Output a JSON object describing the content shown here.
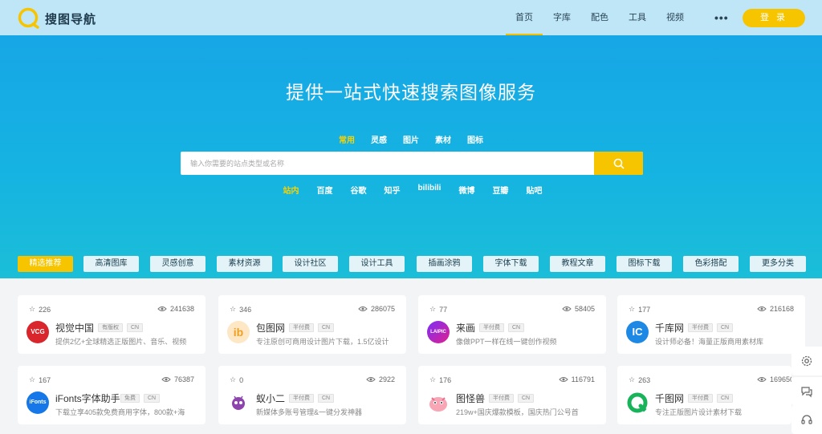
{
  "header": {
    "logo_text": "搜图导航",
    "nav": [
      "首页",
      "字库",
      "配色",
      "工具",
      "视频"
    ],
    "more": "•••",
    "login": "登 录",
    "brand_color": "#f7c400"
  },
  "hero": {
    "title": "提供一站式快速搜索图像服务",
    "tabs": [
      "常用",
      "灵感",
      "图片",
      "素材",
      "图标"
    ],
    "search_placeholder": "输入你需要的站点类型或名称",
    "engines": [
      "站内",
      "百度",
      "谷歌",
      "知乎",
      "bilibili",
      "微博",
      "豆瓣",
      "贴吧"
    ]
  },
  "categories": [
    "精选推荐",
    "高清图库",
    "灵感创意",
    "素材资源",
    "设计社区",
    "设计工具",
    "插画涂鸦",
    "字体下载",
    "教程文章",
    "图标下载",
    "色彩搭配",
    "更多分类"
  ],
  "cards": [
    {
      "stars": "226",
      "views": "241638",
      "name": "视觉中国",
      "tags": [
        "有版权",
        "CN"
      ],
      "desc": "提供2亿+全球精选正版图片、音乐、视频",
      "logo_text": "VCG",
      "logo_icon": "vcg-logo-icon"
    },
    {
      "stars": "346",
      "views": "286075",
      "name": "包图网",
      "tags": [
        "半付费",
        "CN"
      ],
      "desc": "专注原创可商用设计图片下载，1.5亿设计",
      "logo_text": "ib",
      "logo_icon": "baotu-logo-icon"
    },
    {
      "stars": "77",
      "views": "58405",
      "name": "来画",
      "tags": [
        "半付费",
        "CN"
      ],
      "desc": "像做PPT一样在线一键创作视频",
      "logo_text": "LAIPIC",
      "logo_icon": "laihua-logo-icon"
    },
    {
      "stars": "177",
      "views": "216168",
      "name": "千库网",
      "tags": [
        "半付费",
        "CN"
      ],
      "desc": "设计师必备！海量正版商用素材库",
      "logo_text": "IC",
      "logo_icon": "qianku-logo-icon"
    },
    {
      "stars": "167",
      "views": "76387",
      "name": "iFonts字体助手",
      "tags": [
        "免费",
        "CN"
      ],
      "desc": "下载立享405款免费商用字体，800款+海",
      "logo_text": "iFonts",
      "logo_icon": "ifonts-logo-icon"
    },
    {
      "stars": "0",
      "views": "2922",
      "name": "蚁小二",
      "tags": [
        "半付费",
        "CN"
      ],
      "desc": "新媒体多账号管理&一键分发神器",
      "logo_text": "",
      "logo_icon": "yixiaoer-logo-icon"
    },
    {
      "stars": "176",
      "views": "116791",
      "name": "图怪兽",
      "tags": [
        "半付费",
        "CN"
      ],
      "desc": "219w+国庆爆款模板，国庆热门公号首",
      "logo_text": "",
      "logo_icon": "tuguaishou-logo-icon"
    },
    {
      "stars": "263",
      "views": "169650",
      "name": "千图网",
      "tags": [
        "半付费",
        "CN"
      ],
      "desc": "专注正版图片设计素材下载",
      "logo_text": "",
      "logo_icon": "qiantu-logo-icon"
    }
  ],
  "float_tools": [
    "settings-icon",
    "chat-icon",
    "headset-icon"
  ]
}
